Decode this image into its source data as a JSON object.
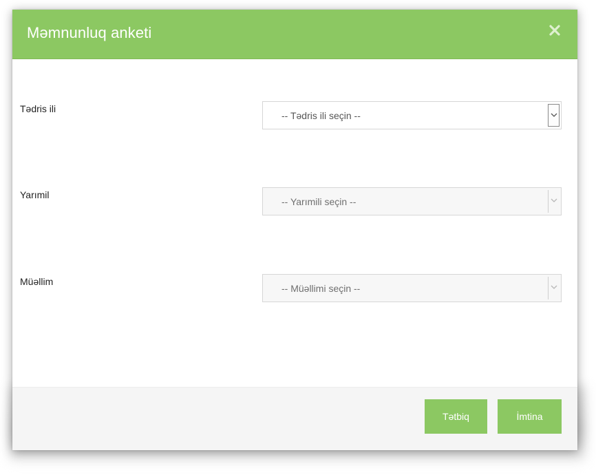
{
  "modal": {
    "title": "Məmnunluq anketi",
    "close_icon": "close-icon"
  },
  "fields": [
    {
      "label": "Tədris ili",
      "placeholder": "-- Tədris ili seçin --",
      "enabled": true
    },
    {
      "label": "Yarımil",
      "placeholder": "-- Yarımili seçin --",
      "enabled": false
    },
    {
      "label": "Müəllim",
      "placeholder": "-- Müəllimi seçin --",
      "enabled": false
    }
  ],
  "footer": {
    "apply_label": "Tətbiq",
    "cancel_label": "İmtina"
  },
  "colors": {
    "accent": "#8cc862",
    "footer_bg": "#f5f5f5",
    "select_border": "#d6d6d6"
  }
}
